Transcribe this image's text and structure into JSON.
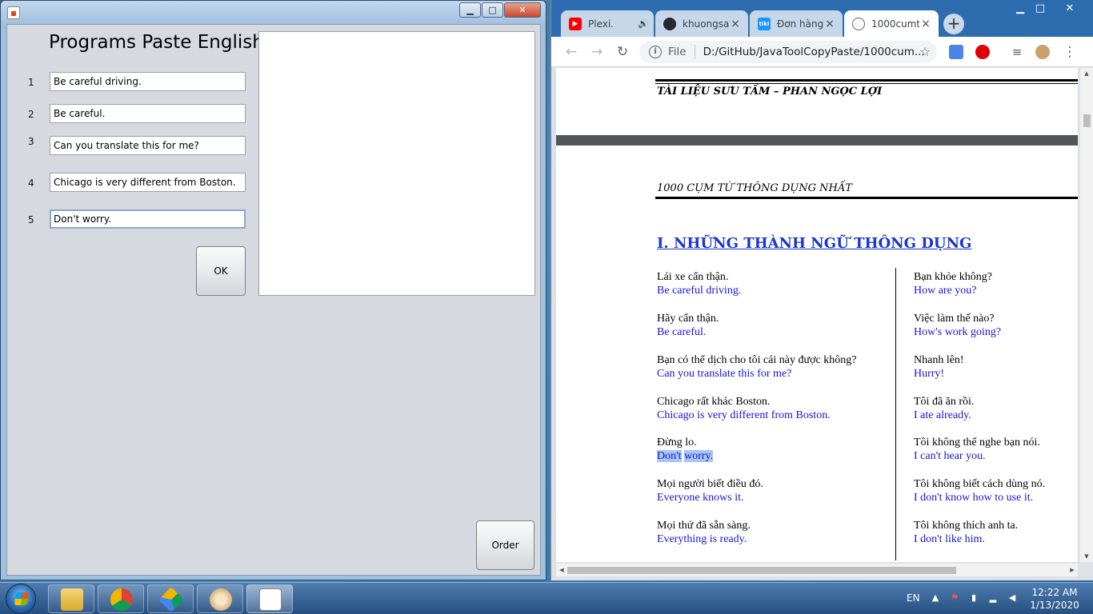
{
  "java_window": {
    "heading": "Programs Paste English",
    "rows": [
      {
        "num": "1",
        "text": "Be careful driving."
      },
      {
        "num": "2",
        "text": "Be careful."
      },
      {
        "num": "3",
        "text": "Can you translate this for me?"
      },
      {
        "num": "4",
        "text": "Chicago is very different from Boston."
      },
      {
        "num": "5",
        "text": "Don't worry."
      }
    ],
    "ok_label": "OK",
    "order_label": "Order",
    "title_controls": {
      "minimize": "▁",
      "maximize": "□",
      "close": "✕"
    }
  },
  "chrome": {
    "tabs": [
      {
        "label": "Plexi.",
        "icon": "youtube-icon",
        "color": "#ff0000",
        "extra": "🔊"
      },
      {
        "label": "khuongsa",
        "icon": "github-icon",
        "color": "#24292e"
      },
      {
        "label": "Đơn hàng",
        "icon": "tiki-icon",
        "color": "#1a94ff"
      },
      {
        "label": "1000cumt",
        "icon": "globe-icon",
        "color": "#5f6368"
      }
    ],
    "tab_close": "×",
    "new_tab": "+",
    "address": {
      "scheme_label": "File",
      "url": "D:/GitHub/JavaToolCopyPaste/1000cum..."
    }
  },
  "document": {
    "page_header": "TÀI LIỆU SƯU TẦM – PHAN NGỌC LỢI",
    "subtitle": "1000 CỤM TỪ THÔNG DỤNG NHẤT",
    "section_title": "I. NHỮNG THÀNH NGỮ THÔNG DỤNG",
    "left_column": [
      {
        "vi": "Lái xe cẩn thận.",
        "en": "Be careful driving."
      },
      {
        "vi": "Hãy cẩn thận.",
        "en": "Be careful."
      },
      {
        "vi": "Bạn có thể dịch cho tôi cái này được không?",
        "en": "Can you translate this for me?"
      },
      {
        "vi": "Chicago rất khác Boston.",
        "en": "Chicago is very different from Boston."
      },
      {
        "vi": "Đừng lo.",
        "en": "Don't worry."
      },
      {
        "vi": "Mọi người biết điều đó.",
        "en": "Everyone knows it."
      },
      {
        "vi": "Mọi thứ đã sẵn sàng.",
        "en": "Everything is ready."
      }
    ],
    "right_column": [
      {
        "vi": "Bạn khỏe không?",
        "en": "How are you?"
      },
      {
        "vi": "Việc làm thế nào?",
        "en": "How's work going?"
      },
      {
        "vi": "Nhanh lên!",
        "en": "Hurry!"
      },
      {
        "vi": "Tôi đã ăn rồi.",
        "en": "I ate already."
      },
      {
        "vi": "Tôi không thể nghe bạn nói.",
        "en": "I can't hear you."
      },
      {
        "vi": "Tôi không biết cách dùng nó.",
        "en": "I don't know how to use it."
      },
      {
        "vi": "Tôi không thích anh ta.",
        "en": "I don't like him."
      }
    ],
    "selected_text": [
      "Don't",
      "worry."
    ],
    "colors": {
      "english_text": "#1616d8",
      "selection": "#a8c6f3",
      "heading": "#1a35d3"
    }
  },
  "taskbar": {
    "apps": [
      "explorer-icon",
      "chrome-icon",
      "google-drive-icon",
      "paint-icon",
      "java-icon"
    ],
    "language": "EN",
    "time": "12:22 AM",
    "date": "1/13/2020"
  }
}
